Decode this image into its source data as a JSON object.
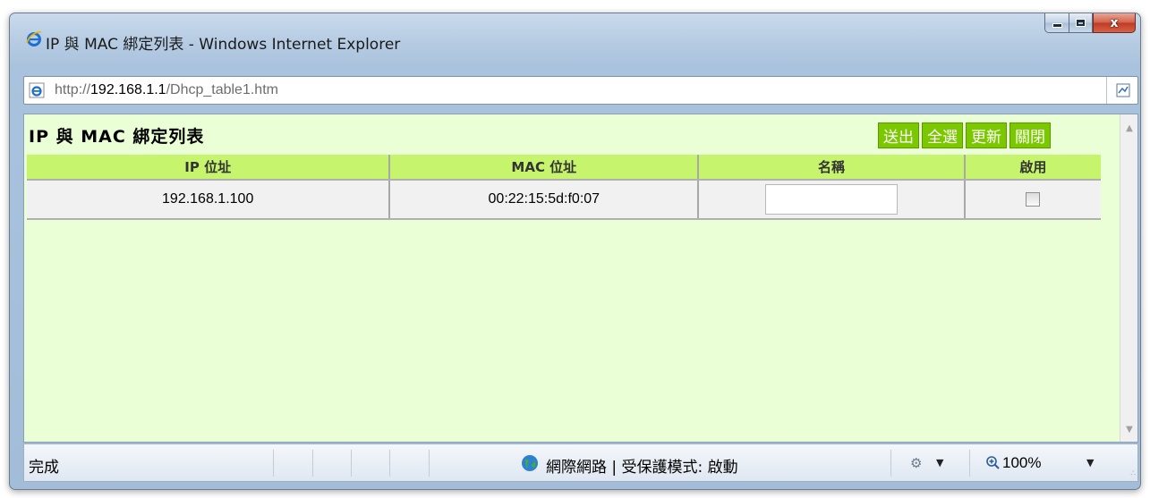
{
  "window": {
    "title": "IP 與 MAC 綁定列表 - Windows Internet Explorer",
    "close_glyph": "x"
  },
  "address": {
    "url_prefix": "http://",
    "url_host": "192.168.1.1",
    "url_path": "/Dhcp_table1.htm"
  },
  "page": {
    "title": "IP 與  MAC 綁定列表",
    "buttons": {
      "submit": "送出",
      "select_all": "全選",
      "refresh": "更新",
      "close": "關閉"
    },
    "table": {
      "headers": {
        "ip": "IP 位址",
        "mac": "MAC 位址",
        "name": "名稱",
        "enable": "啟用"
      },
      "rows": [
        {
          "ip": "192.168.1.100",
          "mac": "00:22:15:5d:f0:07",
          "name": "",
          "enabled": false
        }
      ]
    }
  },
  "status": {
    "text": "完成",
    "zone": "網際網路 | 受保護模式: 啟動",
    "zoom": "100%"
  },
  "colors": {
    "page_bg": "#eaffd5",
    "header_bg": "#c6f56d",
    "button_bg": "#7bc800"
  }
}
